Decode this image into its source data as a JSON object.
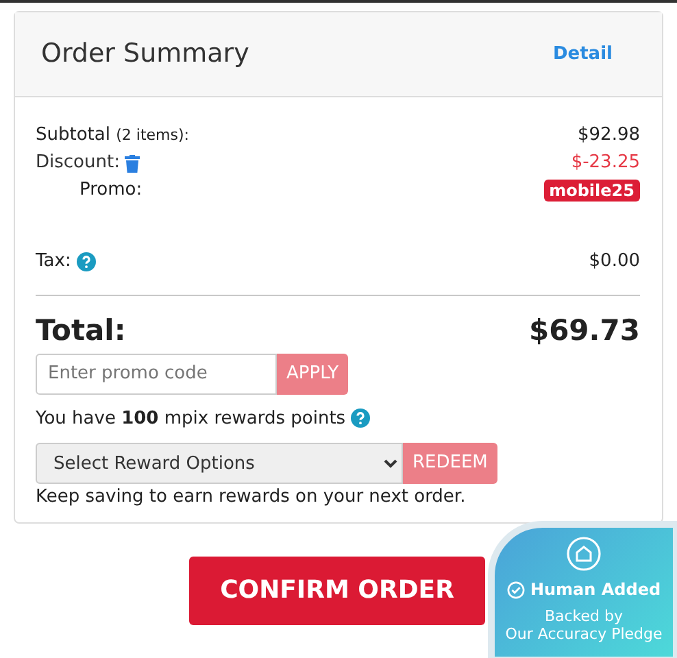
{
  "header": {
    "title": "Order Summary",
    "link": "Detail"
  },
  "lines": [
    {
      "kind": "subtotal",
      "label": "Subtotal",
      "note": "(2 items):",
      "value": "$92.98"
    },
    {
      "kind": "discount",
      "label": "Discount:",
      "value": "$-23.25"
    },
    {
      "kind": "promo",
      "label": "Promo:",
      "badge": "mobile25"
    },
    {
      "kind": "tax",
      "label": "Tax:",
      "value": "$0.00"
    }
  ],
  "total": {
    "label": "Total:",
    "value": "$69.73"
  },
  "promo": {
    "placeholder": "Enter promo code",
    "button": "APPLY"
  },
  "rewards": {
    "text": "You have **100** mpix rewards points",
    "select": "Select Reward Options",
    "button": "REDEEM",
    "note": "Keep saving to earn rewards on your next order."
  },
  "confirm": "CONFIRM ORDER",
  "pledge": {
    "title": "Human Added",
    "text": "Backed by",
    "text2": "Our Accuracy Pledge"
  }
}
